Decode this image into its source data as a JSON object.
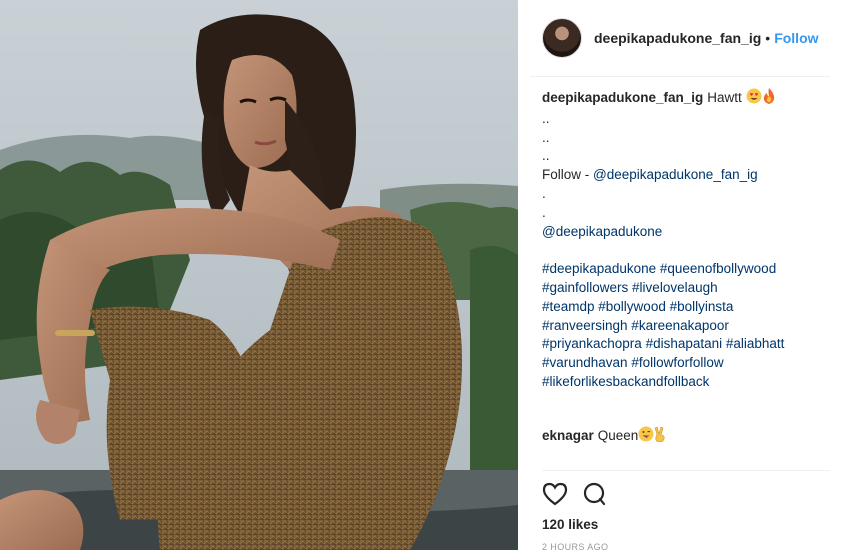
{
  "post": {
    "username": "deepikapadukone_fan_ig",
    "separator": "•",
    "follow_label": "Follow",
    "caption": {
      "text": "Hawtt",
      "dots": [
        "..",
        "..",
        ".."
      ],
      "follow_prefix": "Follow - ",
      "follow_handle": "@deepikapadukone_fan_ig",
      "single_dots": [
        ".",
        "."
      ],
      "mention": "@deepikapadukone",
      "hashtag_lines": [
        "#deepikapadukone #queenofbollywood",
        "#gainfollowers #livelovelaugh",
        "#teamdp #bollywood #bollyinsta",
        "#ranveersingh #kareenakapoor",
        "#priyankachopra #dishapatani #aliabhatt",
        "#varundhavan #followforfollow",
        "#likeforlikesbackandfollback"
      ]
    },
    "comment": {
      "username": "eknagar",
      "text": "Queen"
    },
    "likes": "120 likes",
    "timestamp": "2 HOURS AGO"
  },
  "icons": {
    "like": "heart-icon",
    "comment": "comment-bubble-icon",
    "emoji_1": "heart-eyes-emoji",
    "emoji_2": "fire-emoji",
    "emoji_3": "tongue-wink-emoji",
    "emoji_4": "victory-hand-emoji"
  },
  "colors": {
    "link": "#003569",
    "follow": "#3897f0",
    "text": "#262626"
  }
}
